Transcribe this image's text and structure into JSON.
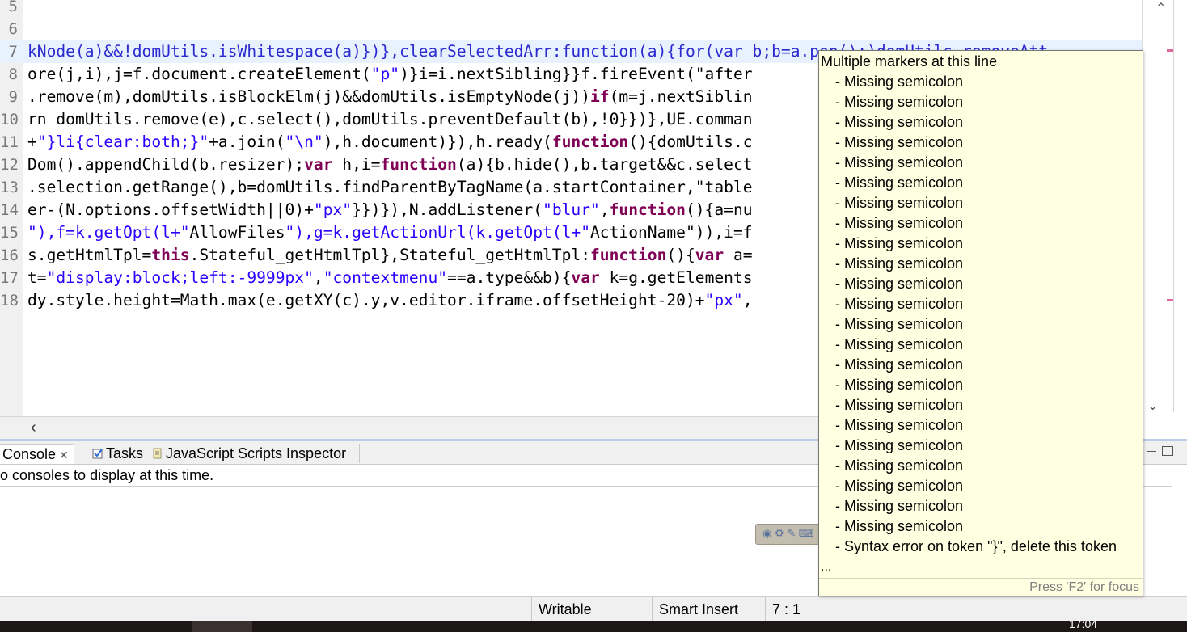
{
  "editor": {
    "lines": [
      {
        "num": "5",
        "code": ""
      },
      {
        "num": "6",
        "code": ""
      },
      {
        "num": "7",
        "code": "kNode(a)&&!domUtils.isWhitespace(a)})},clearSelectedArr:function(a){for(var b;b=a.pop();)domUtils.removeAtt"
      },
      {
        "num": "8",
        "code": "ore(j,i),j=f.document.createElement(\"p\")}i=i.nextSibling}}f.fireEvent(\"after"
      },
      {
        "num": "9",
        "code": ".remove(m),domUtils.isBlockElm(j)&&domUtils.isEmptyNode(j))if(m=j.nextSiblin"
      },
      {
        "num": "10",
        "code": "rn domUtils.remove(e),c.select(),domUtils.preventDefault(b),!0}})},UE.comman"
      },
      {
        "num": "11",
        "code": "+\"}li{clear:both;}\"+a.join(\"\\n\"),h.document)}),h.ready(function(){domUtils.c"
      },
      {
        "num": "12",
        "code": "Dom().appendChild(b.resizer);var h,i=function(a){b.hide(),b.target&&c.select"
      },
      {
        "num": "13",
        "code": ".selection.getRange(),b=domUtils.findParentByTagName(a.startContainer,\"table"
      },
      {
        "num": "14",
        "code": "er-(N.options.offsetWidth||0)+\"px\"}})}),N.addListener(\"blur\",function(){a=nu"
      },
      {
        "num": "15",
        "code": "\"),f=k.getOpt(l+\"AllowFiles\"),g=k.getActionUrl(k.getOpt(l+\"ActionName\")),i=f"
      },
      {
        "num": "16",
        "code": "s.getHtmlTpl=this.Stateful_getHtmlTpl},Stateful_getHtmlTpl:function(){var a="
      },
      {
        "num": "17",
        "code": "t=\"display:block;left:-9999px\",\"contextmenu\"==a.type&&b){var k=g.getElements"
      },
      {
        "num": "18",
        "code": "dy.style.height=Math.max(e.getXY(c).y,v.editor.iframe.offsetHeight-20)+\"px\","
      }
    ]
  },
  "hover": {
    "title": "Multiple markers at this line",
    "items": [
      "- Missing semicolon",
      "- Missing semicolon",
      "- Missing semicolon",
      "- Missing semicolon",
      "- Missing semicolon",
      "- Missing semicolon",
      "- Missing semicolon",
      "- Missing semicolon",
      "- Missing semicolon",
      "- Missing semicolon",
      "- Missing semicolon",
      "- Missing semicolon",
      "- Missing semicolon",
      "- Missing semicolon",
      "- Missing semicolon",
      "- Missing semicolon",
      "- Missing semicolon",
      "- Missing semicolon",
      "- Missing semicolon",
      "- Missing semicolon",
      "- Missing semicolon",
      "- Missing semicolon",
      "- Missing semicolon",
      "- Syntax error on token \"}\", delete this token"
    ],
    "ellipsis": "...",
    "footer": "Press 'F2' for focus"
  },
  "panel": {
    "tabs": {
      "console": "Console",
      "tasks": "Tasks",
      "inspector": "JavaScript Scripts Inspector"
    },
    "message": "o consoles to display at this time."
  },
  "status": {
    "writable": "Writable",
    "insert_mode": "Smart Insert",
    "position": "7 : 1"
  },
  "taskbar": {
    "clock": "17:04"
  },
  "colors": {
    "keyword": "#7f0055",
    "string": "#2a00ff",
    "hover_bg": "#ffffe1",
    "marker": "#e0689e"
  }
}
